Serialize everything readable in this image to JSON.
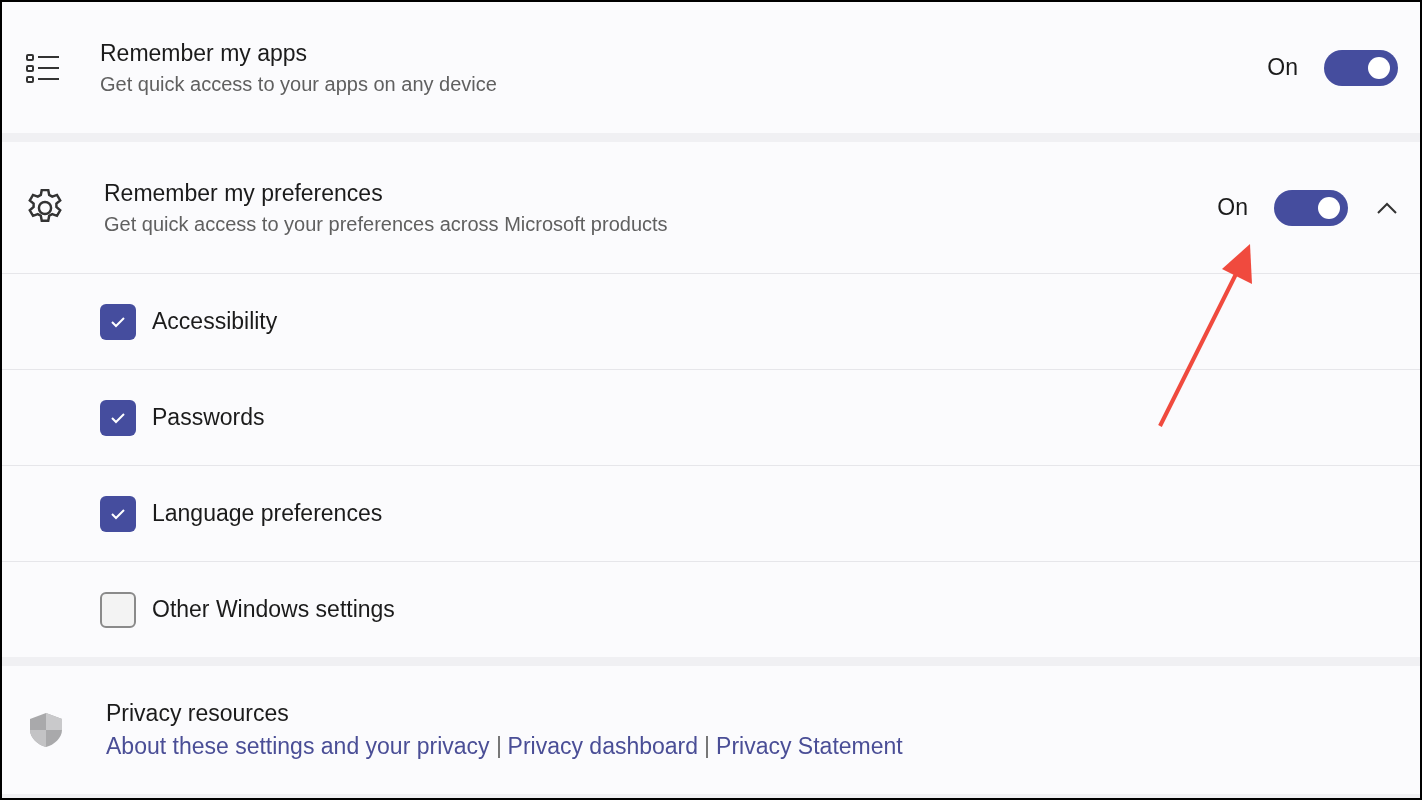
{
  "settings": [
    {
      "kind": "apps",
      "title": "Remember my apps",
      "subtitle": "Get quick access to your apps on any device",
      "status": "On",
      "on": true
    },
    {
      "kind": "preferences",
      "title": "Remember my preferences",
      "subtitle": "Get quick access to your preferences across Microsoft products",
      "status": "On",
      "on": true,
      "expanded": true,
      "options": [
        {
          "label": "Accessibility",
          "checked": true
        },
        {
          "label": "Passwords",
          "checked": true
        },
        {
          "label": "Language preferences",
          "checked": true
        },
        {
          "label": "Other Windows settings",
          "checked": false
        }
      ]
    }
  ],
  "privacy": {
    "title": "Privacy resources",
    "links": [
      {
        "label": "About these settings and your privacy"
      },
      {
        "label": "Privacy dashboard"
      },
      {
        "label": "Privacy Statement"
      }
    ]
  }
}
